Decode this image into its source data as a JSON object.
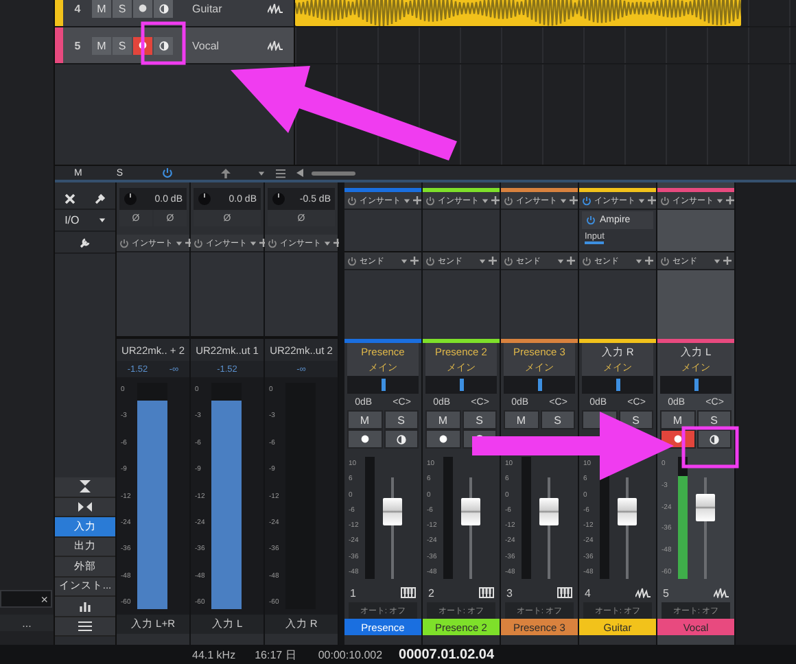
{
  "left_panel": {
    "clear": "×",
    "more": "..."
  },
  "tracks": [
    {
      "number": "4",
      "name": "Guitar",
      "color": "#f2c21b",
      "mute": "M",
      "solo": "S",
      "record": false,
      "monitor": false,
      "selected": false,
      "clip": true
    },
    {
      "number": "5",
      "name": "Vocal",
      "color": "#e84a7f",
      "mute": "M",
      "solo": "S",
      "record": true,
      "monitor": false,
      "selected": true,
      "clip": false
    }
  ],
  "arrange_toolbar": {
    "mute": "M",
    "solo": "S"
  },
  "mixer": {
    "side": {
      "io": "I/O",
      "categories": [
        {
          "label": "入力",
          "selected": true
        },
        {
          "label": "出力",
          "selected": false
        },
        {
          "label": "外部",
          "selected": false
        },
        {
          "label": "インスト...",
          "selected": false
        }
      ]
    },
    "inputs": [
      {
        "gain": "0.0 dB",
        "phase": [
          "Ø",
          "Ø"
        ],
        "insert": "インサート",
        "device": "UR22mk.. + 2",
        "peaks": [
          "-1.52",
          "-∞"
        ],
        "scale": [
          "0",
          "-3",
          "-6",
          "-9",
          "-12",
          "-24",
          "-36",
          "-48",
          "-60"
        ],
        "meter": {
          "level": 0.92
        },
        "label": "入力 L+R"
      },
      {
        "gain": "0.0 dB",
        "phase": [
          "Ø"
        ],
        "insert": "インサート",
        "device": "UR22mk..ut 1",
        "peaks": [
          "-1.52"
        ],
        "scale": [
          "0",
          "-3",
          "-6",
          "-9",
          "-12",
          "-24",
          "-36",
          "-48",
          "-60"
        ],
        "meter": {
          "level": 0.92
        },
        "label": "入力 L"
      },
      {
        "gain": "-0.5 dB",
        "phase": [
          "Ø"
        ],
        "insert": "インサート",
        "device": "UR22mk..ut 2",
        "peaks": [
          "-∞"
        ],
        "scale": [
          "0",
          "-3",
          "-6",
          "-9",
          "-12",
          "-24",
          "-36",
          "-48",
          "-60"
        ],
        "meter": {
          "level": 0
        },
        "label": "入力 R"
      }
    ],
    "channels": [
      {
        "kind": "instrument",
        "color": "#1a6fe0",
        "insert": "インサート",
        "send": "センド",
        "source": "Presence",
        "output": "メイン",
        "pan": {
          "text": "<C>",
          "level": 0.5
        },
        "volume": "0dB",
        "mute": "M",
        "solo": "S",
        "record": false,
        "monitor": false,
        "scale": [
          "10",
          "6",
          "0",
          "-6",
          "-12",
          "-24",
          "-36",
          "-48"
        ],
        "meter": {
          "level": 0
        },
        "fader": {
          "level": 0.72
        },
        "number": "1",
        "automation": "オート: オフ",
        "name": "Presence",
        "selected": false
      },
      {
        "kind": "instrument",
        "color": "#7ee02a",
        "insert": "インサート",
        "send": "センド",
        "source": "Presence 2",
        "output": "メイン",
        "pan": {
          "text": "<C>",
          "level": 0.5
        },
        "volume": "0dB",
        "mute": "M",
        "solo": "S",
        "record": false,
        "monitor": false,
        "scale": [
          "10",
          "6",
          "0",
          "-6",
          "-12",
          "-24",
          "-36",
          "-48"
        ],
        "meter": {
          "level": 0
        },
        "fader": {
          "level": 0.72
        },
        "number": "2",
        "automation": "オート: オフ",
        "name": "Presence 2",
        "selected": false
      },
      {
        "kind": "instrument",
        "color": "#d9823e",
        "insert": "インサート",
        "send": "センド",
        "source": "Presence 3",
        "output": "メイン",
        "pan": {
          "text": "<C>",
          "level": 0.5
        },
        "volume": "0dB",
        "mute": "M",
        "solo": "S",
        "scale": [
          "10",
          "6",
          "0",
          "-6",
          "-12",
          "-24",
          "-36",
          "-48"
        ],
        "meter": {
          "level": 0
        },
        "fader": {
          "level": 0.72
        },
        "number": "3",
        "automation": "オート: オフ",
        "name": "Presence 3",
        "selected": false
      },
      {
        "kind": "audio",
        "color": "#f2c21b",
        "insert": "インサート",
        "inserts": [
          {
            "name": "Ampire",
            "on": true,
            "tab": "Input"
          }
        ],
        "send": "センド",
        "source": "入力 R",
        "output": "メイン",
        "pan": {
          "text": "<C>",
          "level": 0.5
        },
        "volume": "0dB",
        "solo": "S",
        "scale": [
          "10",
          "6",
          "0",
          "-6",
          "-12",
          "-24",
          "-36",
          "-48"
        ],
        "meter": {
          "level": 0
        },
        "fader": {
          "level": 0.72
        },
        "number": "4",
        "automation": "オート: オフ",
        "name": "Guitar",
        "selected": false
      },
      {
        "kind": "audio",
        "color": "#e84a7f",
        "insert": "インサート",
        "send": "センド",
        "source": "入力 L",
        "output": "メイン",
        "pan": {
          "text": "<C>",
          "level": 0.5
        },
        "volume": "0dB",
        "mute": "M",
        "solo": "S",
        "record": true,
        "monitor": false,
        "scale": [
          "0",
          "-3",
          "-24",
          "-36",
          "-48",
          "-60"
        ],
        "meter": {
          "level": 0.84
        },
        "fader": {
          "level": 0.78
        },
        "number": "5",
        "automation": "オート: オフ",
        "name": "Vocal",
        "selected": true
      }
    ]
  },
  "status_bar": {
    "sample_rate": "44.1 kHz",
    "time": "16:17 日",
    "position": "00:00:10.002",
    "bars": "00007.01.02.04"
  }
}
